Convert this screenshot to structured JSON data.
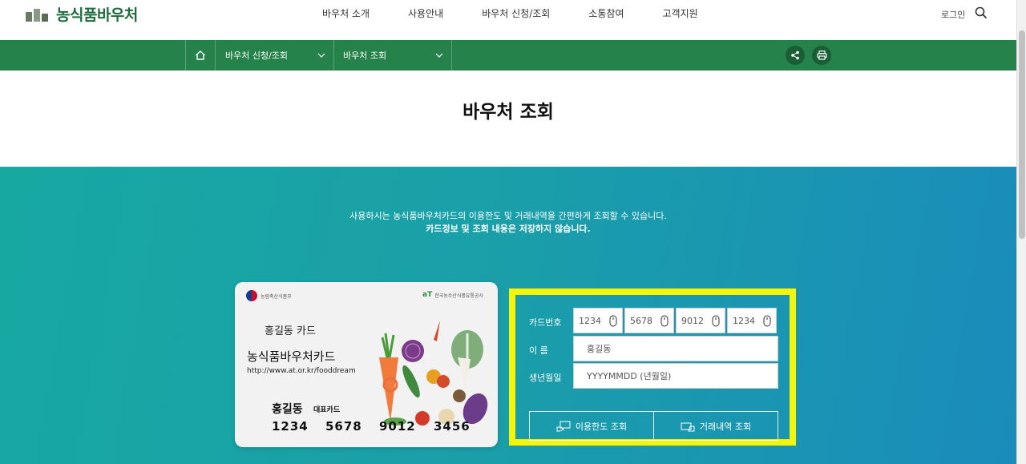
{
  "header": {
    "logo_text": "농식품바우처",
    "nav": [
      "바우처 소개",
      "사용안내",
      "바우처 신청/조회",
      "소통참여",
      "고객지원"
    ],
    "login_label": "로그인"
  },
  "subnav": {
    "crumb1": "바우처 신청/조회",
    "crumb2": "바우처 조회"
  },
  "page_title": "바우처 조회",
  "intro": {
    "line1": "사용하시는 농식품바우처카드의 이용한도 및 거래내역을 간편하게 조회할 수 있습니다.",
    "line2": "카드정보 및 조회 내용은 저장하지 않습니다."
  },
  "card": {
    "ministry": "농림축산식품부",
    "org": "한국농수산식품유통공사",
    "holder_top": "홍길동 카드",
    "name": "농식품바우처카드",
    "url": "http://www.at.or.kr/fooddream",
    "holder": "홍길동",
    "rep_label": "대표카드",
    "numbers": [
      "1234",
      "5678",
      "9012",
      "3456"
    ]
  },
  "form": {
    "card_label": "카드번호",
    "name_label": "이 름",
    "birth_label": "생년월일",
    "card_placeholders": [
      "1234",
      "5678",
      "9012",
      "1234"
    ],
    "name_placeholder": "홍길동",
    "birth_placeholder": "YYYYMMDD (년월일)",
    "limit_button": "이용한도 조회",
    "history_button": "거래내역 조회"
  },
  "colors": {
    "green": "#24824a",
    "highlight": "#f5f50a",
    "gradient_start": "#18a8a2",
    "gradient_end": "#1a8cbb"
  }
}
